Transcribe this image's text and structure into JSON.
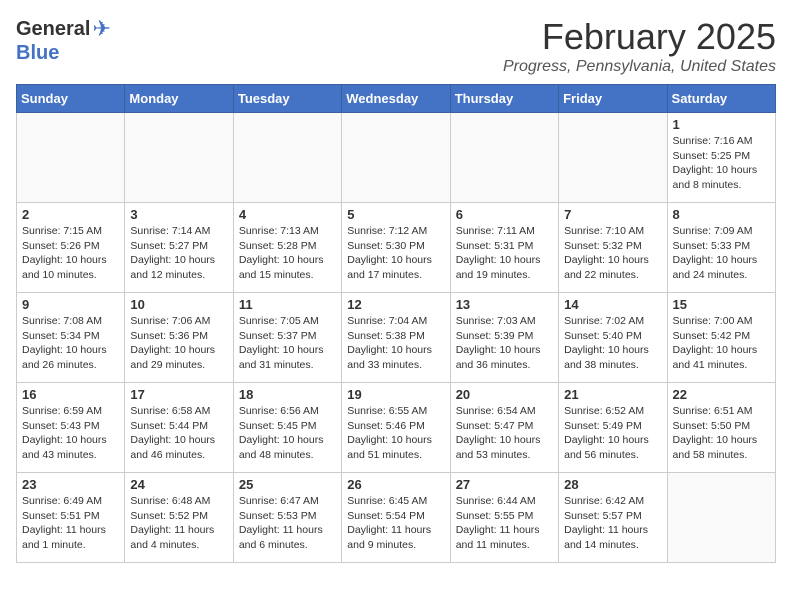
{
  "header": {
    "logo_general": "General",
    "logo_blue": "Blue",
    "month": "February 2025",
    "location": "Progress, Pennsylvania, United States"
  },
  "days_of_week": [
    "Sunday",
    "Monday",
    "Tuesday",
    "Wednesday",
    "Thursday",
    "Friday",
    "Saturday"
  ],
  "weeks": [
    [
      {
        "day": "",
        "info": ""
      },
      {
        "day": "",
        "info": ""
      },
      {
        "day": "",
        "info": ""
      },
      {
        "day": "",
        "info": ""
      },
      {
        "day": "",
        "info": ""
      },
      {
        "day": "",
        "info": ""
      },
      {
        "day": "1",
        "info": "Sunrise: 7:16 AM\nSunset: 5:25 PM\nDaylight: 10 hours\nand 8 minutes."
      }
    ],
    [
      {
        "day": "2",
        "info": "Sunrise: 7:15 AM\nSunset: 5:26 PM\nDaylight: 10 hours\nand 10 minutes."
      },
      {
        "day": "3",
        "info": "Sunrise: 7:14 AM\nSunset: 5:27 PM\nDaylight: 10 hours\nand 12 minutes."
      },
      {
        "day": "4",
        "info": "Sunrise: 7:13 AM\nSunset: 5:28 PM\nDaylight: 10 hours\nand 15 minutes."
      },
      {
        "day": "5",
        "info": "Sunrise: 7:12 AM\nSunset: 5:30 PM\nDaylight: 10 hours\nand 17 minutes."
      },
      {
        "day": "6",
        "info": "Sunrise: 7:11 AM\nSunset: 5:31 PM\nDaylight: 10 hours\nand 19 minutes."
      },
      {
        "day": "7",
        "info": "Sunrise: 7:10 AM\nSunset: 5:32 PM\nDaylight: 10 hours\nand 22 minutes."
      },
      {
        "day": "8",
        "info": "Sunrise: 7:09 AM\nSunset: 5:33 PM\nDaylight: 10 hours\nand 24 minutes."
      }
    ],
    [
      {
        "day": "9",
        "info": "Sunrise: 7:08 AM\nSunset: 5:34 PM\nDaylight: 10 hours\nand 26 minutes."
      },
      {
        "day": "10",
        "info": "Sunrise: 7:06 AM\nSunset: 5:36 PM\nDaylight: 10 hours\nand 29 minutes."
      },
      {
        "day": "11",
        "info": "Sunrise: 7:05 AM\nSunset: 5:37 PM\nDaylight: 10 hours\nand 31 minutes."
      },
      {
        "day": "12",
        "info": "Sunrise: 7:04 AM\nSunset: 5:38 PM\nDaylight: 10 hours\nand 33 minutes."
      },
      {
        "day": "13",
        "info": "Sunrise: 7:03 AM\nSunset: 5:39 PM\nDaylight: 10 hours\nand 36 minutes."
      },
      {
        "day": "14",
        "info": "Sunrise: 7:02 AM\nSunset: 5:40 PM\nDaylight: 10 hours\nand 38 minutes."
      },
      {
        "day": "15",
        "info": "Sunrise: 7:00 AM\nSunset: 5:42 PM\nDaylight: 10 hours\nand 41 minutes."
      }
    ],
    [
      {
        "day": "16",
        "info": "Sunrise: 6:59 AM\nSunset: 5:43 PM\nDaylight: 10 hours\nand 43 minutes."
      },
      {
        "day": "17",
        "info": "Sunrise: 6:58 AM\nSunset: 5:44 PM\nDaylight: 10 hours\nand 46 minutes."
      },
      {
        "day": "18",
        "info": "Sunrise: 6:56 AM\nSunset: 5:45 PM\nDaylight: 10 hours\nand 48 minutes."
      },
      {
        "day": "19",
        "info": "Sunrise: 6:55 AM\nSunset: 5:46 PM\nDaylight: 10 hours\nand 51 minutes."
      },
      {
        "day": "20",
        "info": "Sunrise: 6:54 AM\nSunset: 5:47 PM\nDaylight: 10 hours\nand 53 minutes."
      },
      {
        "day": "21",
        "info": "Sunrise: 6:52 AM\nSunset: 5:49 PM\nDaylight: 10 hours\nand 56 minutes."
      },
      {
        "day": "22",
        "info": "Sunrise: 6:51 AM\nSunset: 5:50 PM\nDaylight: 10 hours\nand 58 minutes."
      }
    ],
    [
      {
        "day": "23",
        "info": "Sunrise: 6:49 AM\nSunset: 5:51 PM\nDaylight: 11 hours\nand 1 minute."
      },
      {
        "day": "24",
        "info": "Sunrise: 6:48 AM\nSunset: 5:52 PM\nDaylight: 11 hours\nand 4 minutes."
      },
      {
        "day": "25",
        "info": "Sunrise: 6:47 AM\nSunset: 5:53 PM\nDaylight: 11 hours\nand 6 minutes."
      },
      {
        "day": "26",
        "info": "Sunrise: 6:45 AM\nSunset: 5:54 PM\nDaylight: 11 hours\nand 9 minutes."
      },
      {
        "day": "27",
        "info": "Sunrise: 6:44 AM\nSunset: 5:55 PM\nDaylight: 11 hours\nand 11 minutes."
      },
      {
        "day": "28",
        "info": "Sunrise: 6:42 AM\nSunset: 5:57 PM\nDaylight: 11 hours\nand 14 minutes."
      },
      {
        "day": "",
        "info": ""
      }
    ]
  ]
}
